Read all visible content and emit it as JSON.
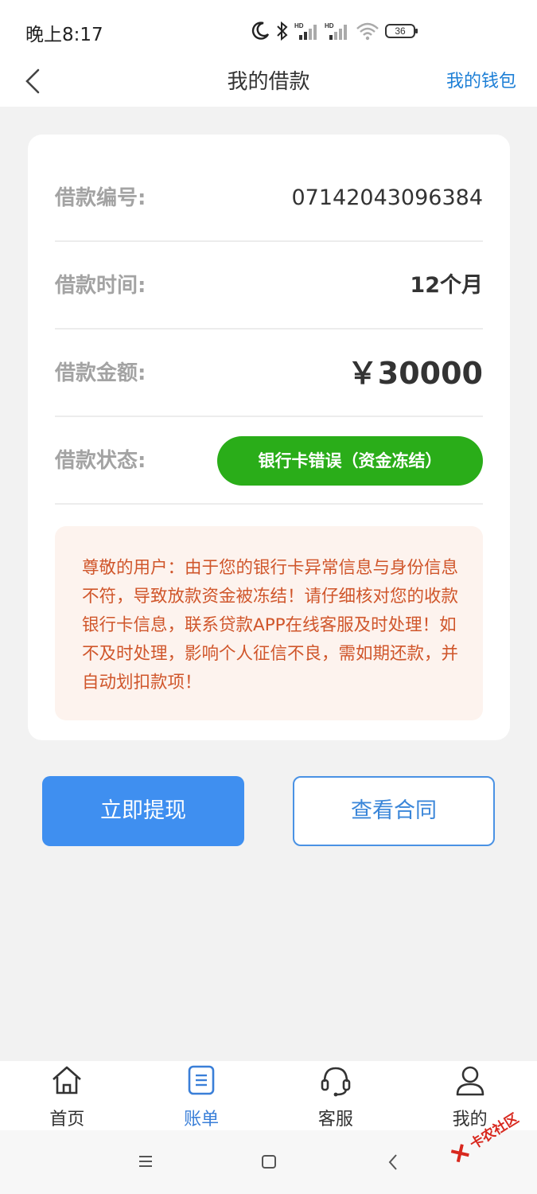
{
  "status_bar": {
    "time": "晚上8:17",
    "battery": "36",
    "icons": [
      "moon-icon",
      "bluetooth-icon",
      "signal-hd-icon",
      "signal-hd-icon",
      "wifi-icon",
      "battery-icon"
    ]
  },
  "nav": {
    "title": "我的借款",
    "right_link": "我的钱包",
    "back_icon": "chevron-left-icon"
  },
  "loan": {
    "rows": [
      {
        "label": "借款编号:",
        "value": "07142043096384"
      },
      {
        "label": "借款时间:",
        "value": "12个月"
      },
      {
        "label": "借款金额:",
        "value": "￥30000"
      },
      {
        "label": "借款状态:",
        "value": "银行卡错误（资金冻结）"
      }
    ],
    "notice": "尊敬的用户：由于您的银行卡异常信息与身份信息不符，导致放款资金被冻结！请仔细核对您的收款银行卡信息，联系贷款APP在线客服及时处理！如不及时处理，影响个人征信不良，需如期还款，并自动划扣款项！"
  },
  "actions": {
    "primary": "立即提现",
    "secondary": "查看合同"
  },
  "tabs": [
    {
      "label": "首页",
      "icon": "home-icon",
      "active": false
    },
    {
      "label": "账单",
      "icon": "bill-icon",
      "active": true
    },
    {
      "label": "客服",
      "icon": "headset-icon",
      "active": false
    },
    {
      "label": "我的",
      "icon": "user-icon",
      "active": false
    }
  ],
  "watermark": "卡农社区",
  "colors": {
    "accent": "#3f8ff0",
    "status_green": "#2aad19",
    "notice_text": "#d0562b",
    "notice_bg": "#fdf3ee",
    "link": "#1d7fd6"
  }
}
